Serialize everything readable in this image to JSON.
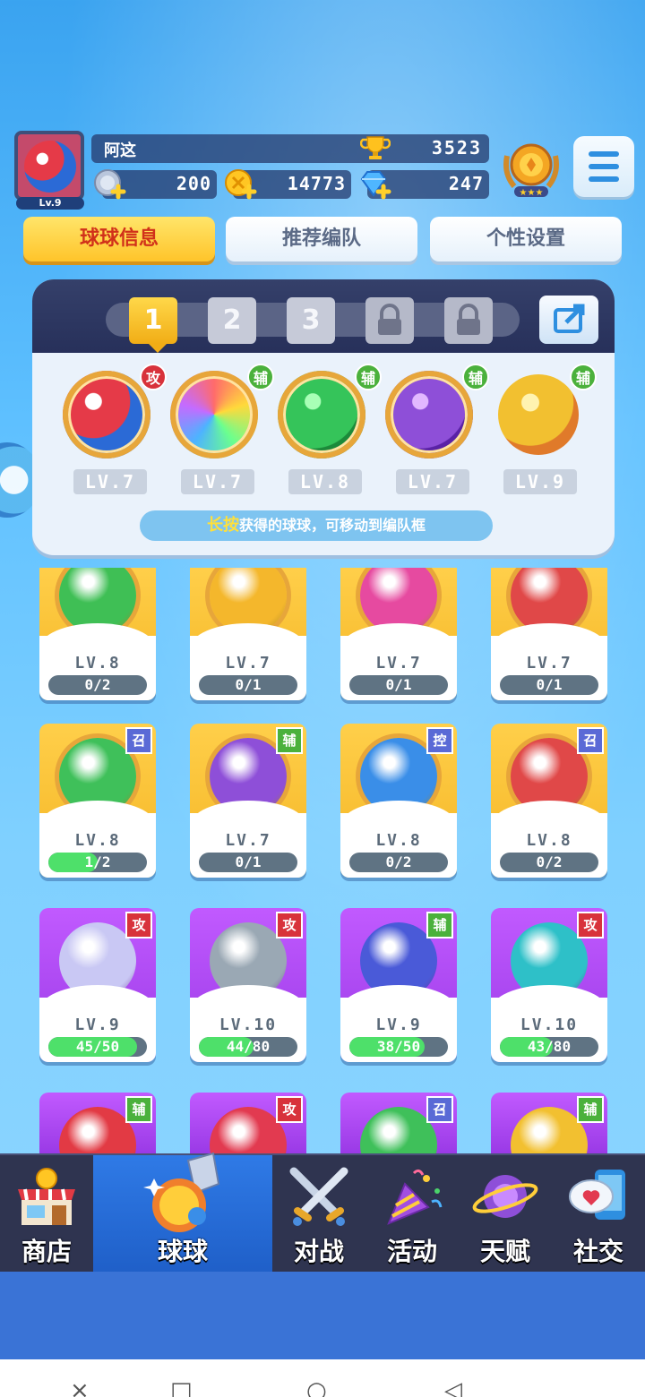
{
  "player": {
    "name": "阿这",
    "level": "Lv.9",
    "trophies": "3523",
    "resource_1": "200",
    "resource_2": "14773",
    "gems": "247"
  },
  "tabs": [
    {
      "label": "球球信息",
      "active": true
    },
    {
      "label": "推荐编队",
      "active": false
    },
    {
      "label": "个性设置",
      "active": false
    }
  ],
  "formation": {
    "slots": [
      "1",
      "2",
      "3"
    ],
    "team": [
      {
        "tag": "攻",
        "level": "LV.7",
        "color": "red"
      },
      {
        "tag": "辅",
        "level": "LV.7",
        "color": "rainbow"
      },
      {
        "tag": "辅",
        "level": "LV.8",
        "color": "green"
      },
      {
        "tag": "辅",
        "level": "LV.7",
        "color": "purple"
      },
      {
        "tag": "辅",
        "level": "LV.9",
        "color": "gold"
      }
    ],
    "hint_highlight": "长按",
    "hint_rest": "获得的球球，可移动到编队框"
  },
  "cards": [
    {
      "level": "LV.8",
      "progress": "0/2",
      "pct": 0,
      "tag": "",
      "frame": "gold",
      "orb": "#3fbf55"
    },
    {
      "level": "LV.7",
      "progress": "0/1",
      "pct": 0,
      "tag": "",
      "frame": "gold",
      "orb": "#f4b72c"
    },
    {
      "level": "LV.7",
      "progress": "0/1",
      "pct": 0,
      "tag": "",
      "frame": "gold",
      "orb": "#e64aa0"
    },
    {
      "level": "LV.7",
      "progress": "0/1",
      "pct": 0,
      "tag": "",
      "frame": "gold",
      "orb": "#e04848"
    },
    {
      "level": "LV.8",
      "progress": "1/2",
      "pct": 50,
      "tag": "召",
      "frame": "gold",
      "orb": "#3fc05a"
    },
    {
      "level": "LV.7",
      "progress": "0/1",
      "pct": 0,
      "tag": "辅",
      "frame": "gold",
      "orb": "#8e4fd8"
    },
    {
      "level": "LV.8",
      "progress": "0/2",
      "pct": 0,
      "tag": "控",
      "frame": "gold",
      "orb": "#3a8ee8"
    },
    {
      "level": "LV.8",
      "progress": "0/2",
      "pct": 0,
      "tag": "召",
      "frame": "gold",
      "orb": "#e04848"
    },
    {
      "level": "LV.9",
      "progress": "45/50",
      "pct": 90,
      "tag": "攻",
      "frame": "purple",
      "orb": "#c9c8f4"
    },
    {
      "level": "LV.10",
      "progress": "44/80",
      "pct": 55,
      "tag": "攻",
      "frame": "purple",
      "orb": "#9aa8b4"
    },
    {
      "level": "LV.9",
      "progress": "38/50",
      "pct": 76,
      "tag": "辅",
      "frame": "purple",
      "orb": "#4a5ad8"
    },
    {
      "level": "LV.10",
      "progress": "43/80",
      "pct": 54,
      "tag": "攻",
      "frame": "purple",
      "orb": "#2ec0c8"
    }
  ],
  "partial_cards": [
    {
      "tag": "辅",
      "orb": "#e23a44"
    },
    {
      "tag": "攻",
      "orb": "#e23a50"
    },
    {
      "tag": "召",
      "orb": "#3fc05a"
    },
    {
      "tag": "辅",
      "orb": "#f2c030"
    }
  ],
  "nav": [
    {
      "label": "商店",
      "icon": "shop-icon",
      "active": false
    },
    {
      "label": "球球",
      "icon": "ball-icon",
      "active": true
    },
    {
      "label": "对战",
      "icon": "crossed-swords-icon",
      "active": false
    },
    {
      "label": "活动",
      "icon": "party-popper-icon",
      "active": false
    },
    {
      "label": "天赋",
      "icon": "planet-icon",
      "active": false
    },
    {
      "label": "社交",
      "icon": "chat-icon",
      "active": false
    }
  ],
  "system_nav": {
    "back": "◁",
    "home": "○",
    "recents": "□",
    "close": "×"
  }
}
